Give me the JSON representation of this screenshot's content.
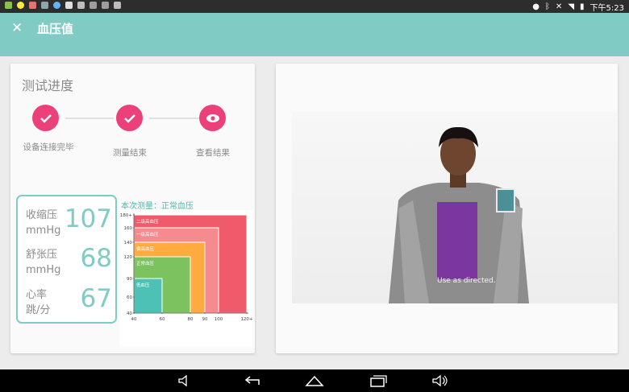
{
  "status_bar": {
    "time": "下午5:23",
    "icons": [
      "photo-icon",
      "brightness-icon",
      "mail-icon",
      "settings-icon",
      "browser-icon",
      "mail-icon",
      "wifi-off-icon",
      "usb-icon",
      "usb-icon",
      "sd-card-icon",
      "location-icon",
      "bluetooth-icon",
      "no-sim-icon",
      "wifi-icon",
      "battery-icon"
    ]
  },
  "app_bar": {
    "close_icon": "close-icon",
    "title": "血压值"
  },
  "progress": {
    "title": "测试进度",
    "steps": [
      {
        "label": "设备连接完毕",
        "icon": "check-icon",
        "done": true
      },
      {
        "label": "测量结束",
        "icon": "check-icon",
        "done": true
      },
      {
        "label": "查看结果",
        "icon": "eye-icon",
        "done": false
      }
    ]
  },
  "vitals": [
    {
      "label1": "收缩压",
      "label2": "mmHg",
      "value": "107"
    },
    {
      "label1": "舒张压",
      "label2": "mmHg",
      "value": "68"
    },
    {
      "label1": "心率",
      "label2": "跳/分",
      "value": "67"
    }
  ],
  "result": {
    "text": "本次测量：正常血压"
  },
  "chart_data": {
    "type": "area",
    "x_ticks": [
      "40",
      "60",
      "80",
      "90",
      "100",
      "120+"
    ],
    "y_ticks": [
      "40",
      "60",
      "90",
      "120",
      "140",
      "160",
      "180+"
    ],
    "xlim": [
      40,
      120
    ],
    "ylim": [
      40,
      180
    ],
    "zones": [
      {
        "name": "二级高血压",
        "x_max": 120,
        "y_max": 180,
        "color": "#ef5b6a"
      },
      {
        "name": "一级高血压",
        "x_max": 100,
        "y_max": 160,
        "color": "#f58a8f"
      },
      {
        "name": "偏高血压",
        "x_max": 90,
        "y_max": 140,
        "color": "#ffab40"
      },
      {
        "name": "正常血压",
        "x_max": 80,
        "y_max": 120,
        "color": "#7cc35f"
      },
      {
        "name": "低血压",
        "x_max": 60,
        "y_max": 90,
        "color": "#4dc1b4"
      }
    ]
  },
  "video": {
    "caption": "Use as directed."
  },
  "nav_bar": [
    "volume-down-icon",
    "back-icon",
    "home-icon",
    "recents-icon",
    "volume-up-icon"
  ]
}
